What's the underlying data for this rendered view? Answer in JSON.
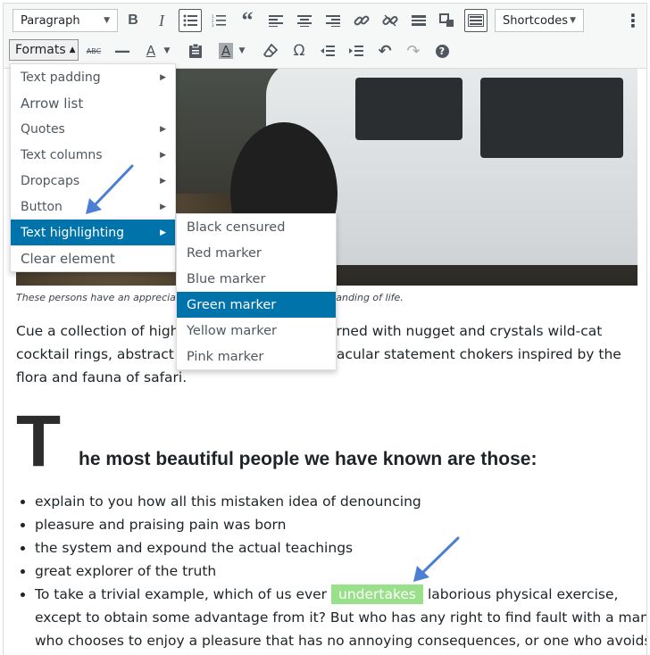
{
  "toolbar": {
    "block_format": "Paragraph",
    "shortcodes_label": "Shortcodes",
    "formats_label": "Formats",
    "kebab": "⋮",
    "row1_icons": [
      "bold-icon",
      "italic-icon",
      "bullet-list-icon",
      "numbered-list-icon",
      "blockquote-icon",
      "align-left-icon",
      "align-center-icon",
      "align-right-icon",
      "link-icon",
      "unlink-icon",
      "read-more-icon",
      "shortcode-insert-icon",
      "toolbar-toggle-icon"
    ],
    "row2_icons": [
      "strikethrough-icon",
      "horizontal-line-icon",
      "text-color-icon",
      "paste-text-icon",
      "background-color-icon",
      "clear-formatting-icon",
      "special-character-icon",
      "outdent-icon",
      "indent-icon",
      "undo-icon",
      "redo-icon",
      "help-icon"
    ],
    "glyphs": {
      "bold": "B",
      "italic": "I",
      "bullets": "☰",
      "numbers": "☷",
      "quote": "“",
      "align_left": "≡",
      "align_center": "≡",
      "align_right": "≡",
      "link": "⚭",
      "unlink": "⚮",
      "more": "━",
      "shortcode": "❒",
      "toggle": "⌨",
      "strike": "ABC",
      "hr": "—",
      "color": "A",
      "paste": "⎘",
      "bgcolor": "A",
      "eraser": "⌂",
      "omega": "Ω",
      "outdent": "⇤",
      "indent": "⇥",
      "undo": "↶",
      "redo": "↷",
      "help": "?"
    }
  },
  "formats_menu": {
    "items": [
      {
        "label": "Text padding",
        "submenu": true
      },
      {
        "label": "Arrow list",
        "submenu": false
      },
      {
        "label": "Quotes",
        "submenu": true
      },
      {
        "label": "Text columns",
        "submenu": true
      },
      {
        "label": "Dropcaps",
        "submenu": true
      },
      {
        "label": "Button",
        "submenu": true
      },
      {
        "label": "Text highlighting",
        "submenu": true
      },
      {
        "label": "Clear element",
        "submenu": false
      }
    ],
    "selected": "Text highlighting"
  },
  "highlight_submenu": {
    "items": [
      "Black censured",
      "Red marker",
      "Blue marker",
      "Green marker",
      "Yellow marker",
      "Pink marker"
    ],
    "selected": "Green marker"
  },
  "content": {
    "caption": "These persons have an apprecia",
    "caption_end": "tanding of life.",
    "para_line1_start": "Cue a collection of high",
    "para_line1_end": "rned with nugget and crystals wild-cat",
    "para_line2_start": "cocktail rings, abstract",
    "para_line2_end": "tacular statement chokers inspired by the",
    "para_line3": "flora and fauna of safari.",
    "dropcap": "T",
    "heading": "he most beautiful people we have known are those:",
    "list": [
      "explain to you how all this mistaken idea of denouncing",
      "pleasure and praising pain was born",
      "the system and expound the actual teachings",
      "great explorer of the truth"
    ],
    "last_item_before": "To take a trivial example, which of us ever ",
    "last_item_highlight": "undertakes",
    "last_item_after": " laborious physical exercise, except to obtain some advantage from it? But who has any right to find fault with a man who chooses to enjoy a pleasure that has no annoying consequences, or one who avoids"
  },
  "colors": {
    "accent": "#0073aa",
    "highlight_green": "#98e08a",
    "annotation_arrow": "#4a7fd4"
  }
}
